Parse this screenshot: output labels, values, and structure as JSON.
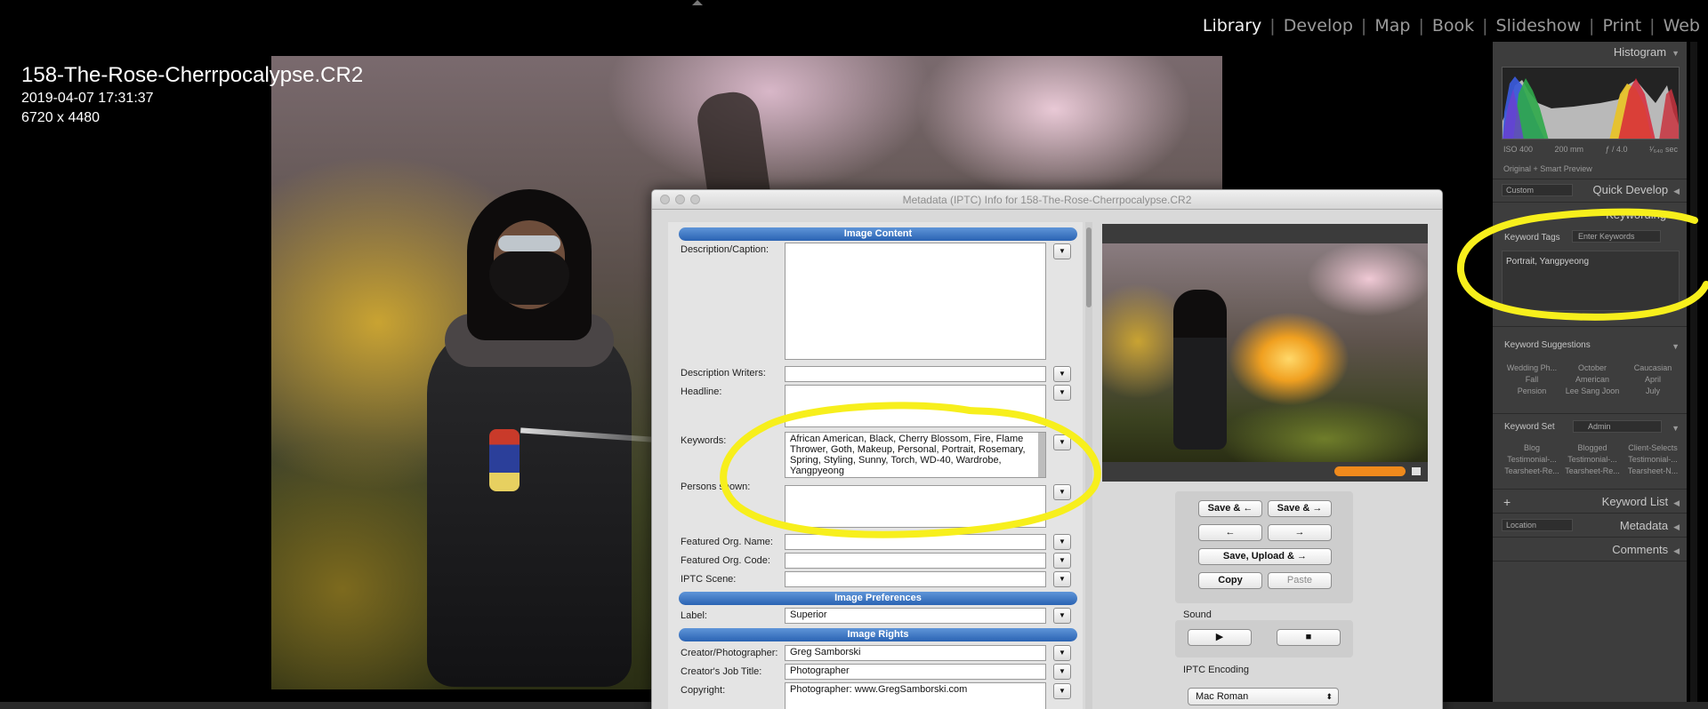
{
  "modules": [
    "Library",
    "Develop",
    "Map",
    "Book",
    "Slideshow",
    "Print",
    "Web"
  ],
  "active_module": "Library",
  "photo_info": {
    "filename": "158-The-Rose-Cherrpocalypse.CR2",
    "datetime": "2019-04-07 17:31:37",
    "dimensions": "6720 x 4480"
  },
  "dialog": {
    "title": "Metadata (IPTC) Info for 158-The-Rose-Cherrpocalypse.CR2",
    "sections": {
      "content": "Image Content",
      "preferences": "Image Preferences",
      "rights": "Image Rights"
    },
    "fields": {
      "description_label": "Description/Caption:",
      "description_writers_label": "Description Writers:",
      "headline_label": "Headline:",
      "keywords_label": "Keywords:",
      "keywords_value": "African American, Black, Cherry Blossom, Fire, Flame Thrower, Goth, Makeup, Personal, Portrait, Rosemary, Spring, Styling, Sunny, Torch, WD-40, Wardrobe, Yangpyeong",
      "persons_label": "Persons shown:",
      "featured_org_name_label": "Featured Org. Name:",
      "featured_org_code_label": "Featured Org. Code:",
      "iptc_scene_label": "IPTC Scene:",
      "label_label": "Label:",
      "label_value": "Superior",
      "creator_label": "Creator/Photographer:",
      "creator_value": "Greg Samborski",
      "job_title_label": "Creator's Job Title:",
      "job_title_value": "Photographer",
      "copyright_label": "Copyright:",
      "copyright_value": "Photographer: www.GregSamborski.com"
    },
    "buttons": {
      "save_prev": "Save & ←",
      "save_next": "Save & →",
      "prev": "←",
      "next": "→",
      "save_upload": "Save, Upload & →",
      "copy": "Copy",
      "paste": "Paste",
      "play": "▶",
      "stop": "■"
    },
    "sound_label": "Sound",
    "iptc_encoding_label": "IPTC Encoding",
    "encoding_value": "Mac Roman",
    "dropdown_glyph": "▼",
    "select_glyph": "⬍"
  },
  "right_panel": {
    "histogram": "Histogram",
    "histogram_meta": [
      "ISO 400",
      "200 mm",
      "ƒ / 4.0",
      "¹⁄₆₄₀ sec"
    ],
    "smart_preview": "Original + Smart Preview",
    "quick_develop": "Quick Develop",
    "quick_develop_preset": "Custom",
    "keywording": "Keywording",
    "keyword_tags_label": "Keyword Tags",
    "keyword_tags_mode": "Enter Keywords",
    "keyword_tags_value": "Portrait, Yangpyeong",
    "keyword_suggestions": "Keyword Suggestions",
    "suggestions": [
      "Wedding Ph...",
      "October",
      "Caucasian",
      "Fall",
      "American",
      "April",
      "Pension",
      "Lee Sang Joon",
      "July"
    ],
    "keyword_set_label": "Keyword Set",
    "keyword_set_value": "Admin",
    "keyword_set_items": [
      "Blog",
      "Blogged",
      "Client-Selects",
      "Testimonial-...",
      "Testimonial-...",
      "Testimonial-...",
      "Tearsheet-Re...",
      "Tearsheet-Re...",
      "Tearsheet-N..."
    ],
    "keyword_list": "Keyword List",
    "metadata": "Metadata",
    "metadata_preset": "Location",
    "comments": "Comments",
    "plus": "+",
    "expand_glyph": "▼",
    "collapse_glyph": "◀"
  },
  "colors": {
    "annotation": "#f7ef1c",
    "section_blue": "#2a63b3",
    "progress_orange": "#f08a1c"
  }
}
